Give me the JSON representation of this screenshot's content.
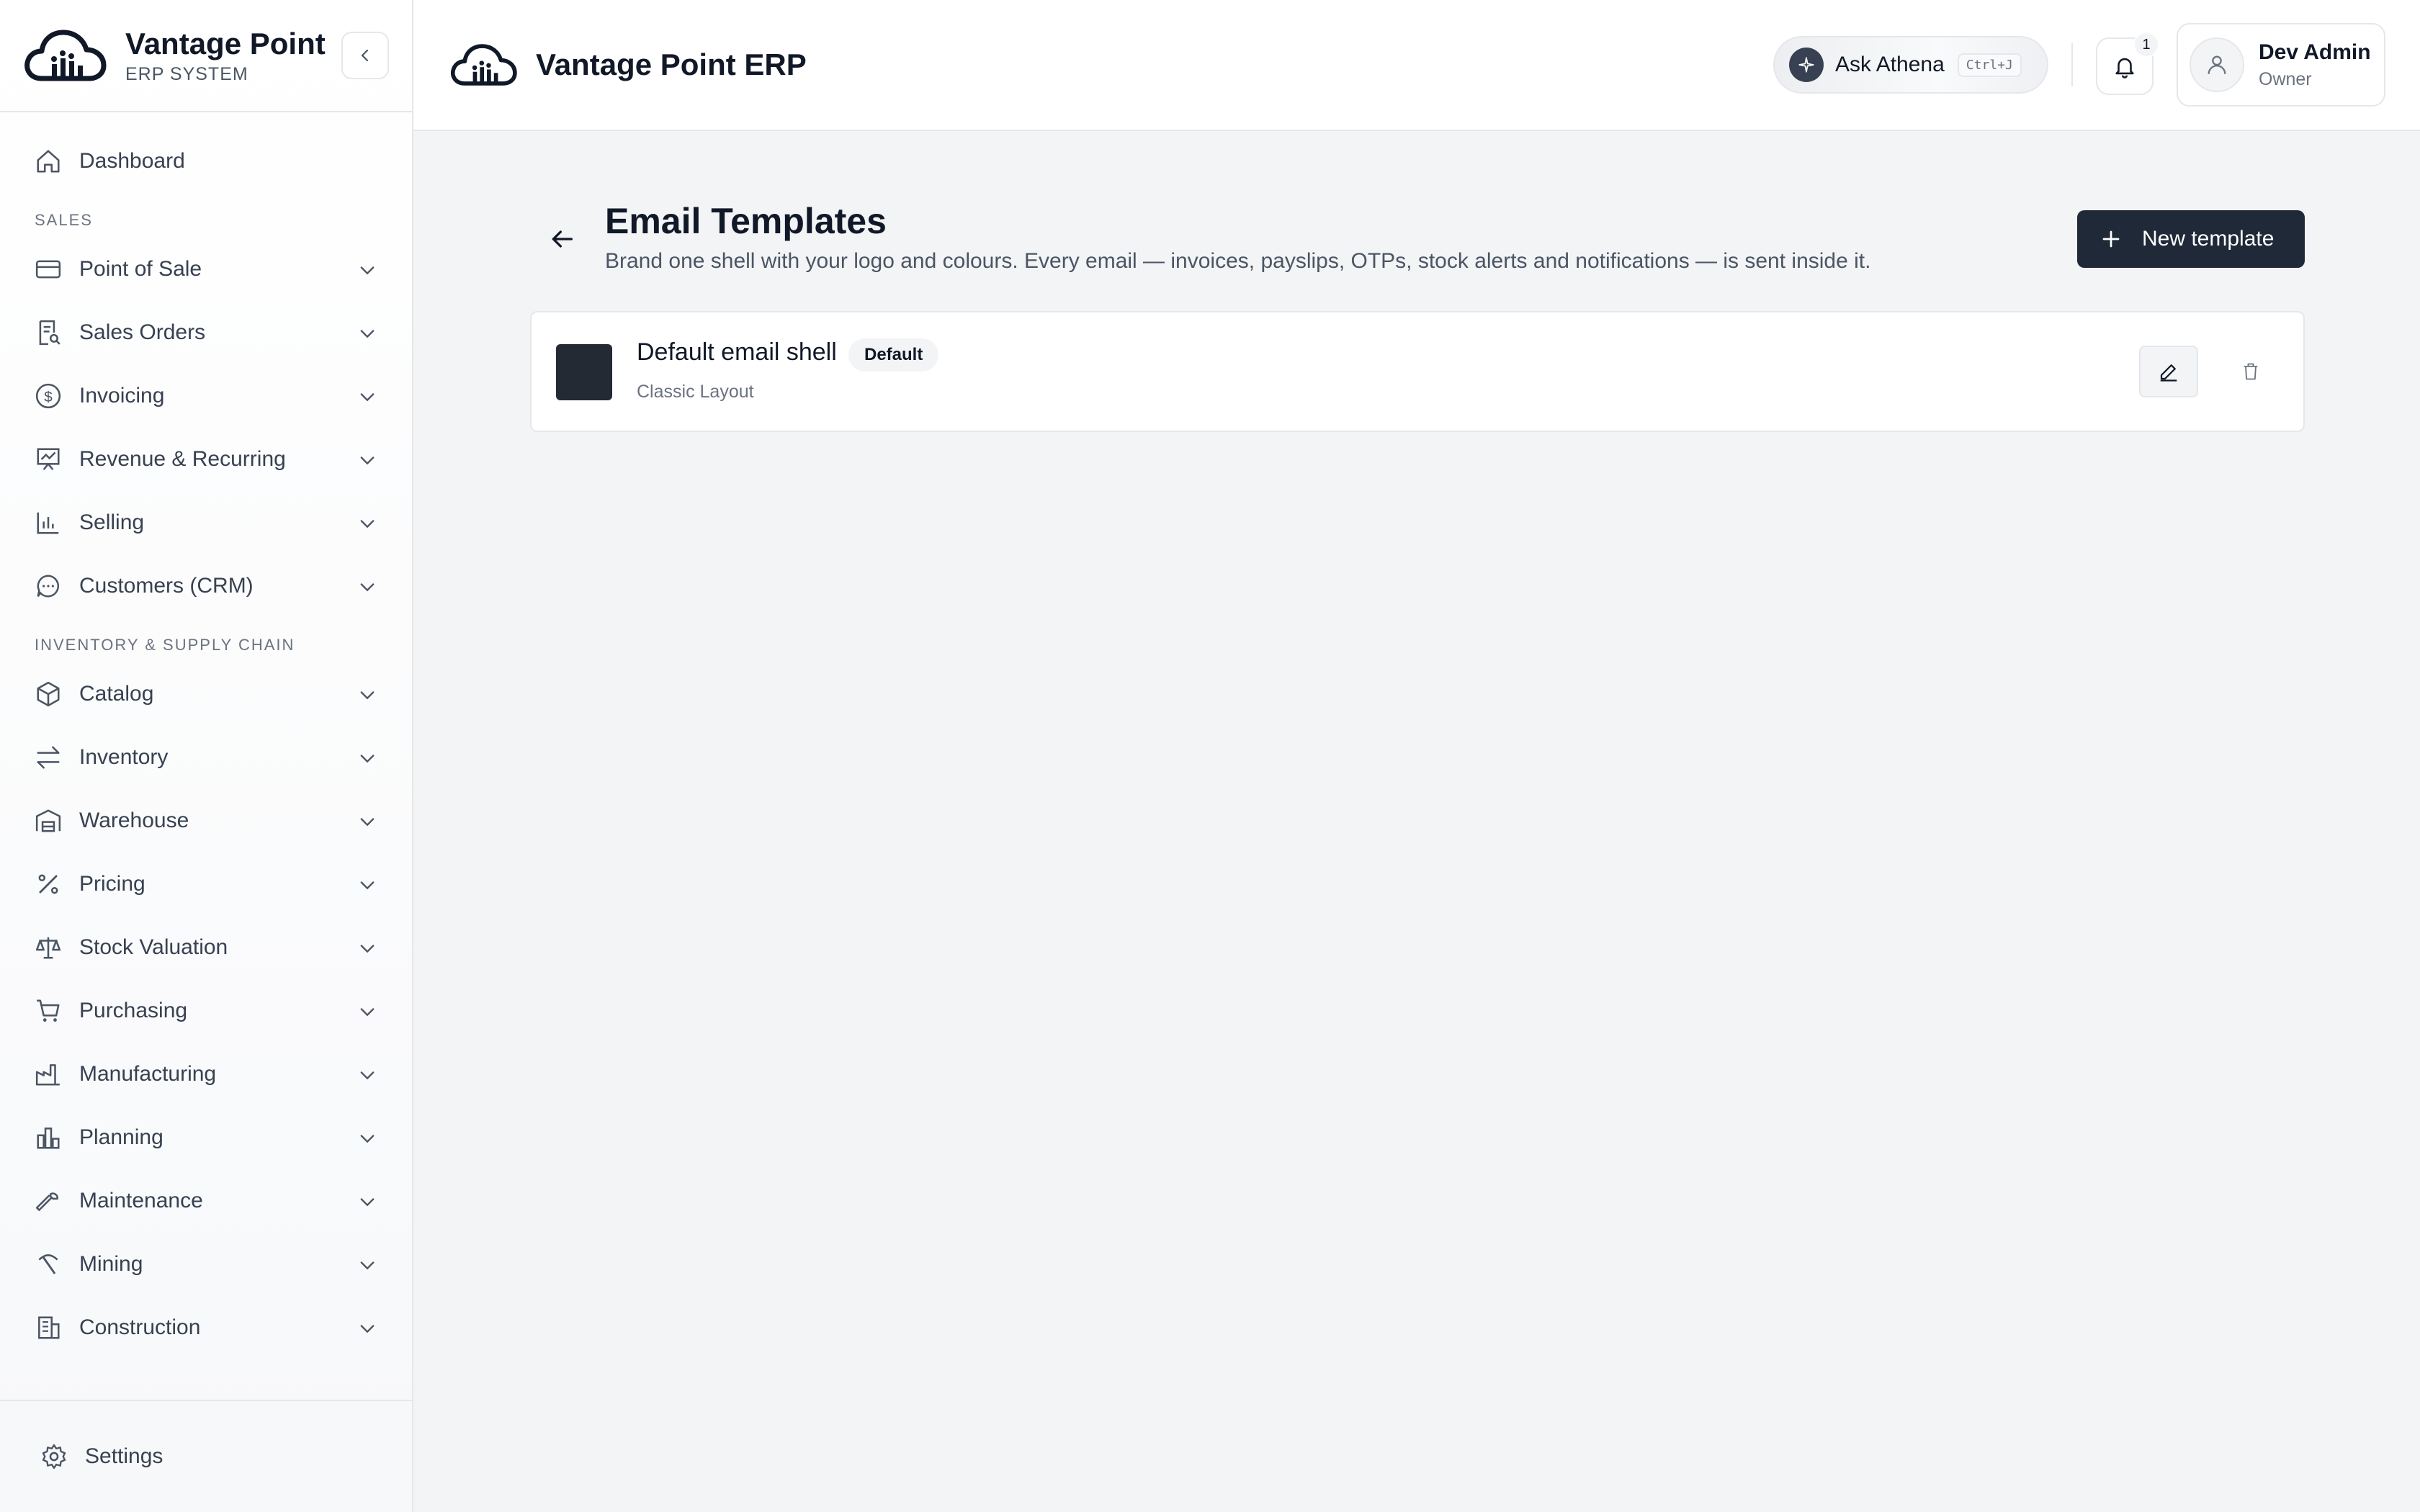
{
  "brand": {
    "name": "Vantage Point",
    "subtitle": "ERP SYSTEM"
  },
  "header": {
    "title": "Vantage Point ERP",
    "assistant_label": "Ask Athena",
    "assistant_shortcut": "Ctrl+J",
    "notification_count": "1",
    "user_name": "Dev Admin",
    "user_role": "Owner"
  },
  "sidebar": {
    "dashboard": "Dashboard",
    "sales_section": "SALES",
    "sales_items": [
      {
        "label": "Point of Sale",
        "icon": "card-icon"
      },
      {
        "label": "Sales Orders",
        "icon": "receipt-icon"
      },
      {
        "label": "Invoicing",
        "icon": "dollar-circle-icon"
      },
      {
        "label": "Revenue & Recurring",
        "icon": "presentation-chart-icon"
      },
      {
        "label": "Selling",
        "icon": "bar-chart-icon"
      },
      {
        "label": "Customers (CRM)",
        "icon": "chat-bubble-icon"
      }
    ],
    "inventory_section": "INVENTORY & SUPPLY CHAIN",
    "inventory_items": [
      {
        "label": "Catalog",
        "icon": "box-icon"
      },
      {
        "label": "Inventory",
        "icon": "transfer-icon"
      },
      {
        "label": "Warehouse",
        "icon": "warehouse-icon"
      },
      {
        "label": "Pricing",
        "icon": "percent-icon"
      },
      {
        "label": "Stock Valuation",
        "icon": "scale-icon"
      },
      {
        "label": "Purchasing",
        "icon": "cart-icon"
      },
      {
        "label": "Manufacturing",
        "icon": "factory-icon"
      },
      {
        "label": "Planning",
        "icon": "columns-icon"
      },
      {
        "label": "Maintenance",
        "icon": "wrench-icon"
      },
      {
        "label": "Mining",
        "icon": "pickaxe-icon"
      },
      {
        "label": "Construction",
        "icon": "building-icon"
      }
    ],
    "settings": "Settings"
  },
  "page": {
    "title": "Email Templates",
    "subtitle": "Brand one shell with your logo and colours. Every email — invoices, payslips, OTPs, stock alerts and notifications — is sent inside it.",
    "new_button": "New template"
  },
  "templates": [
    {
      "name": "Default email shell",
      "badge": "Default",
      "layout": "Classic Layout",
      "swatch_color": "#242a33"
    }
  ],
  "colors": {
    "primary": "#1f2937",
    "border": "#e5e7eb",
    "background": "#f3f4f6"
  }
}
